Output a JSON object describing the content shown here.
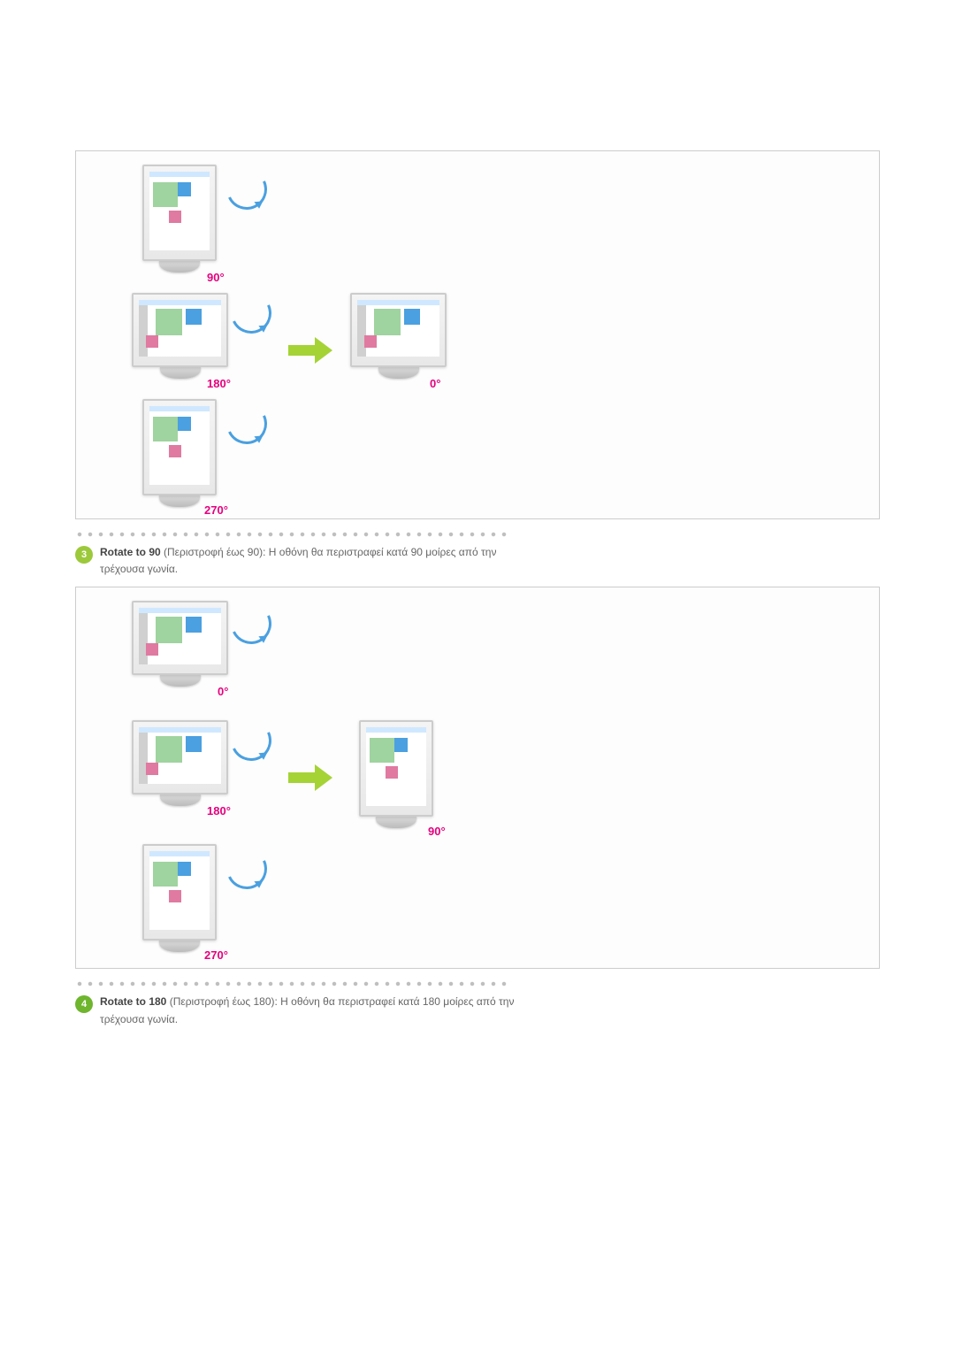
{
  "item3": {
    "bullet": "3",
    "bold": "Rotate to 90",
    "rest": " (Περιστροφή έως 90): Η οθόνη θα περιστραφεί κατά 90 μοίρες από την τρέχουσα γωνία."
  },
  "item4": {
    "bullet": "4",
    "bold": "Rotate to 180",
    "rest": " (Περιστροφή έως 180): Η οθόνη θα περιστραφεί κατά 180 μοίρες από την τρέχουσα γωνία."
  },
  "fig1": {
    "a90": "90°",
    "a180": "180°",
    "a270": "270°",
    "a0": "0°"
  },
  "fig2": {
    "a0": "0°",
    "a180": "180°",
    "a270": "270°",
    "a90": "90°"
  }
}
